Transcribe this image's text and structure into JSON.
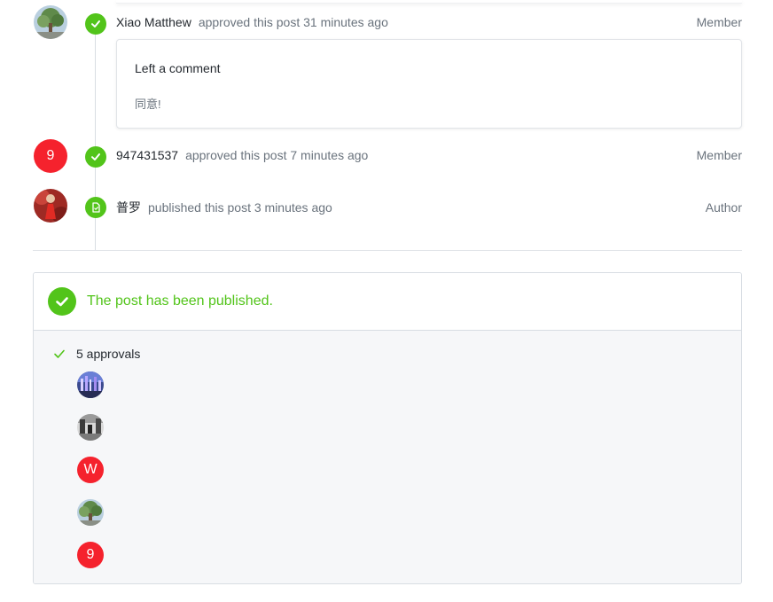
{
  "timeline": {
    "events": [
      {
        "user": "Xiao Matthew",
        "action": "approved this post 31 minutes ago",
        "role": "Member",
        "badge_icon": "check-icon",
        "avatar": "tree-photo-avatar"
      },
      {
        "user": "947431537",
        "action": "approved this post 7 minutes ago",
        "role": "Member",
        "badge_icon": "check-icon",
        "avatar_letter": "9"
      },
      {
        "user": "普罗",
        "action": "published this post 3 minutes ago",
        "role": "Author",
        "badge_icon": "document-icon",
        "avatar": "red-dress-photo-avatar"
      }
    ],
    "comment": {
      "title": "Left a comment",
      "body": "同意!"
    }
  },
  "status": {
    "message": "The post has been published.",
    "approvals_label": "5 approvals",
    "approvers": [
      {
        "type": "photo",
        "icon": "city-night-avatar"
      },
      {
        "type": "photo",
        "icon": "street-photo-avatar"
      },
      {
        "type": "letter",
        "letter": "W"
      },
      {
        "type": "photo",
        "icon": "tree-photo-avatar"
      },
      {
        "type": "letter",
        "letter": "9"
      }
    ]
  },
  "colors": {
    "success": "#52c41a",
    "avatar_red": "#f5222d",
    "muted_text": "#6a737d",
    "panel_bg": "#f6f7f9"
  }
}
